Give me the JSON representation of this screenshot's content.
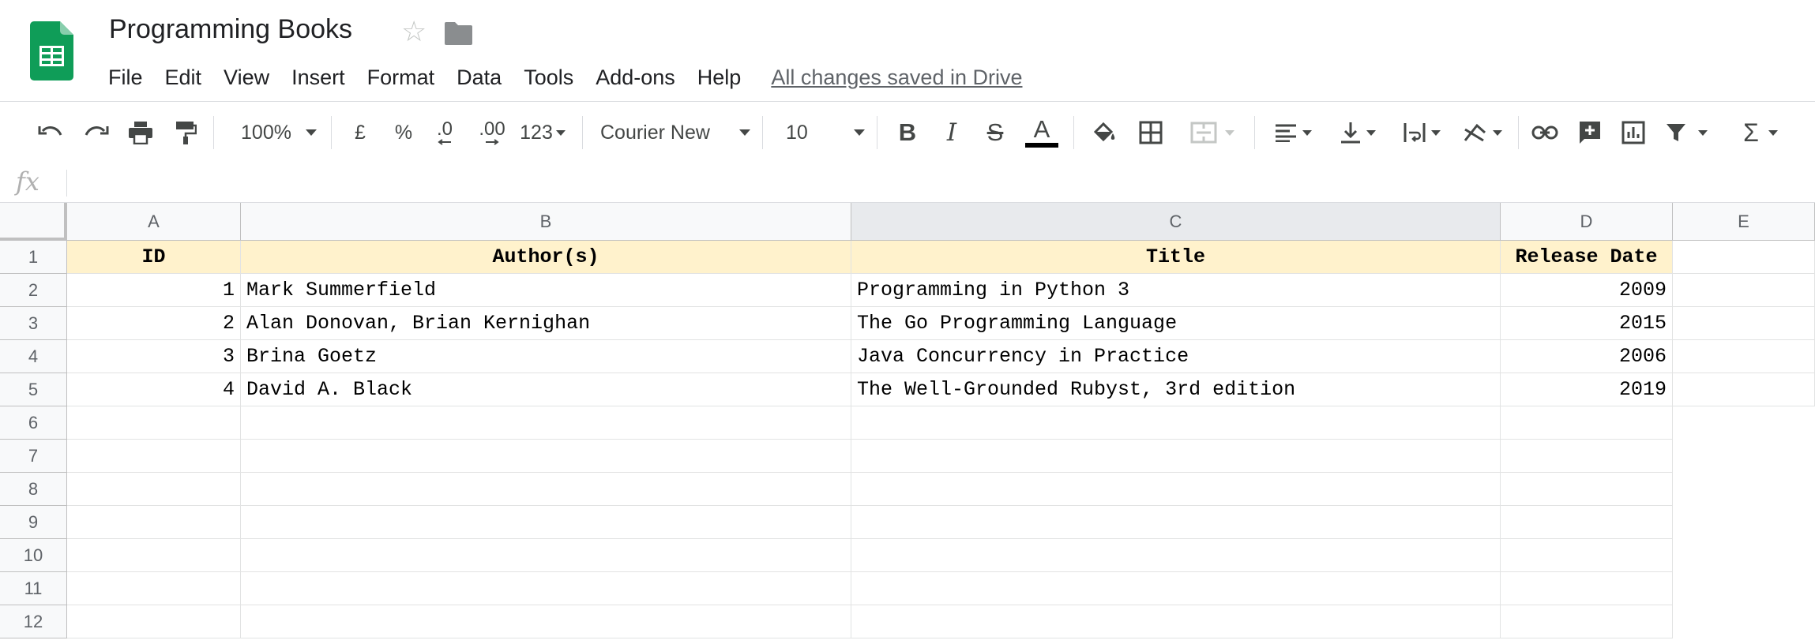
{
  "app": {
    "title": "Programming Books",
    "save_status": "All changes saved in Drive",
    "menu": [
      "File",
      "Edit",
      "View",
      "Insert",
      "Format",
      "Data",
      "Tools",
      "Add-ons",
      "Help"
    ]
  },
  "toolbar": {
    "zoom": "100%",
    "currency": "£",
    "percent": "%",
    "decrease_decimal": ".0",
    "increase_decimal": ".00",
    "more_formats": "123",
    "font": "Courier New",
    "font_size": "10",
    "text_color": "#000000"
  },
  "formula_bar": {
    "label": "fx",
    "value": ""
  },
  "grid": {
    "columns": [
      "A",
      "B",
      "C",
      "D",
      "E"
    ],
    "selected_column": "C",
    "rows": [
      "1",
      "2",
      "3",
      "4",
      "5",
      "6",
      "7",
      "8",
      "9",
      "10",
      "11",
      "12"
    ],
    "header": [
      "ID",
      "Author(s)",
      "Title",
      "Release Date"
    ],
    "data": [
      [
        "1",
        "Mark Summerfield",
        "Programming in Python 3",
        "2009"
      ],
      [
        "2",
        "Alan Donovan, Brian Kernighan",
        "The Go Programming Language",
        "2015"
      ],
      [
        "3",
        "Brina Goetz",
        "Java Concurrency in Practice",
        "2006"
      ],
      [
        "4",
        "David A. Black",
        "The Well-Grounded Rubyst, 3rd edition",
        "2019"
      ]
    ],
    "header_fill": "#fff2cc"
  },
  "colors": {
    "sheets_green": "#0f9d58",
    "icon_gray": "#444746"
  }
}
